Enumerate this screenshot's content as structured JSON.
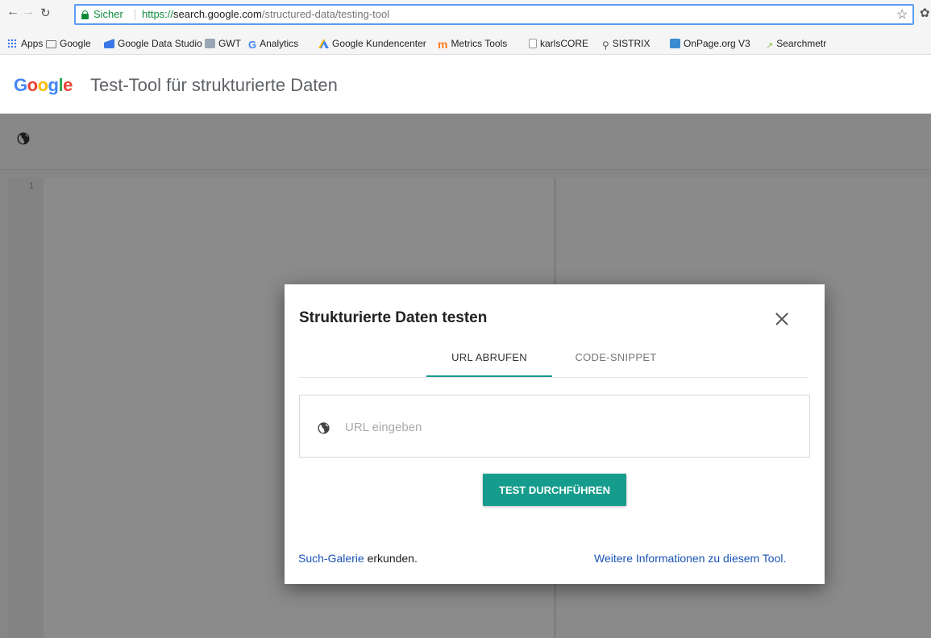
{
  "browser": {
    "secure_label": "Sicher",
    "url_scheme": "https://",
    "url_host": "search.google.com",
    "url_path": "/structured-data/testing-tool",
    "omnibox_border_color": "#5b9bf2",
    "secure_color": "#118a3c"
  },
  "bookmarks": [
    {
      "label": "Apps",
      "icon": "apps-grid-icon"
    },
    {
      "label": "Google",
      "icon": "folder-icon"
    },
    {
      "label": "Google Data Studio",
      "icon": "data-studio-icon"
    },
    {
      "label": "GWT",
      "icon": "gwt-icon"
    },
    {
      "label": "Analytics",
      "icon": "google-g-icon"
    },
    {
      "label": "Google Kundencenter",
      "icon": "google-ads-icon"
    },
    {
      "label": "Metrics Tools",
      "icon": "metrics-icon"
    },
    {
      "label": "karlsCORE",
      "icon": "document-icon"
    },
    {
      "label": "SISTRIX",
      "icon": "search-icon"
    },
    {
      "label": "OnPage.org V3",
      "icon": "onpage-icon"
    },
    {
      "label": "Searchmetr",
      "icon": "searchmetrics-icon"
    }
  ],
  "header": {
    "logo": [
      "G",
      "o",
      "o",
      "g",
      "l",
      "e"
    ],
    "title": "Test-Tool für strukturierte Daten"
  },
  "editor": {
    "line_number": "1"
  },
  "dialog": {
    "title": "Strukturierte Daten testen",
    "tabs": [
      {
        "label": "URL ABRUFEN",
        "active": true
      },
      {
        "label": "CODE-SNIPPET",
        "active": false
      }
    ],
    "url_placeholder": "URL eingeben",
    "run_button": "TEST DURCHFÜHREN",
    "footer_link": "Such-Galerie",
    "footer_text": " erkunden.",
    "info_link": "Weitere Informationen zu diesem Tool.",
    "accent_color": "#169c8c"
  }
}
